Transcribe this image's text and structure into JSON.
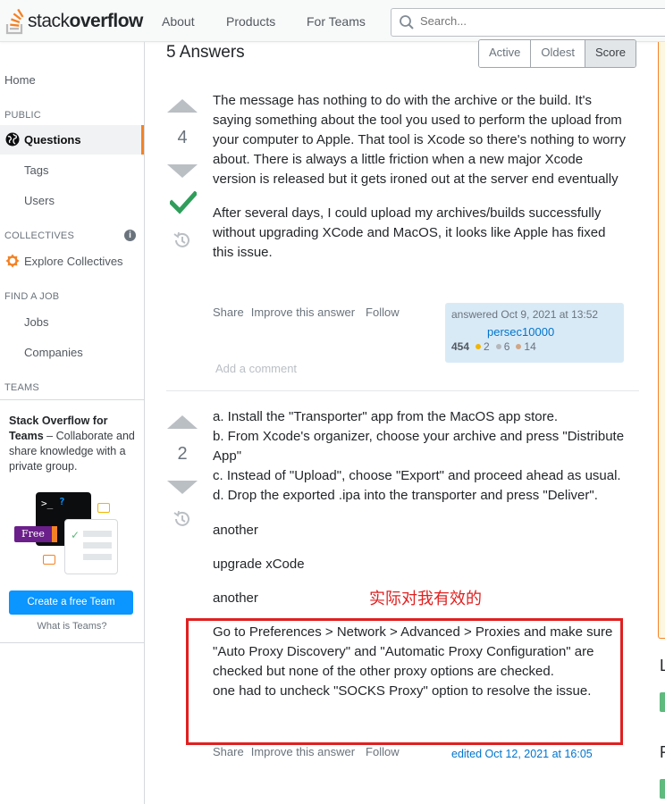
{
  "header": {
    "logo_plain": "stack",
    "logo_bold": "overflow",
    "nav": [
      "About",
      "Products",
      "For Teams"
    ],
    "search_placeholder": "Search..."
  },
  "sidebar": {
    "home": "Home",
    "public_label": "PUBLIC",
    "questions": "Questions",
    "tags": "Tags",
    "users": "Users",
    "collectives_label": "COLLECTIVES",
    "explore_collectives": "Explore Collectives",
    "find_job_label": "FIND A JOB",
    "jobs": "Jobs",
    "companies": "Companies",
    "teams_label": "TEAMS",
    "teams_title_bold": "Stack Overflow for Teams",
    "teams_title_rest": " – Collaborate and share knowledge with a private group.",
    "free_badge": "Free",
    "create_team": "Create a free Team",
    "what_is_teams": "What is Teams?"
  },
  "main": {
    "answers_count": "5 Answers",
    "sort_tabs": [
      "Active",
      "Oldest",
      "Score"
    ],
    "answer1": {
      "votes": "4",
      "paragraphs": [
        "The message has nothing to do with the archive or the build. It's saying something about the tool you used to perform the upload from your computer to Apple. That tool is Xcode so there's nothing to worry about. There is always a little friction when a new major Xcode version is released but it gets ironed out at the server end eventually",
        "After several days, I could upload my archives/builds successfully without upgrading XCode and MacOS, it looks like Apple has fixed this issue."
      ],
      "menu": [
        "Share",
        "Improve this answer",
        "Follow"
      ],
      "answered": "answered Oct 9, 2021 at 13:52",
      "user": "persec10000",
      "rep": "454",
      "gold": "2",
      "silver": "6",
      "bronze": "14",
      "add_comment": "Add a comment"
    },
    "answer2": {
      "votes": "2",
      "lines": [
        "a. Install the \"Transporter\" app from the MacOS app store.",
        "b. From Xcode's organizer, choose your archive and press \"Distribute App\"",
        "c. Instead of \"Upload\", choose \"Export\" and proceed ahead as usual.",
        "d. Drop the exported .ipa into the transporter and press \"Deliver\"."
      ],
      "another1": "another",
      "upgrade": "upgrade xCode",
      "another2": "another",
      "proxy_lines": [
        "Go to Preferences > Network > Advanced > Proxies and make sure \"Auto Proxy Discovery\" and \"Automatic Proxy Configuration\" are checked but none of the other proxy options are checked.",
        "one had to uncheck \"SOCKS Proxy\" option to resolve the issue."
      ],
      "menu": [
        "Share",
        "Improve this answer",
        "Follow"
      ],
      "edited": "edited Oct 12, 2021 at 16:05"
    },
    "annotation": "实际对我有效的"
  },
  "right_edge": {
    "letter1": "L",
    "letter2": "R"
  },
  "colors": {
    "accent_orange": "#f48225",
    "link_blue": "#0074cc",
    "accepted_green": "#2f9e5b",
    "annotation_red": "#e02020",
    "cta_blue": "#0a95ff"
  },
  "icons": [
    "search-icon",
    "globe-icon",
    "info-icon",
    "collectives-icon",
    "vote-up-icon",
    "vote-down-icon",
    "accepted-check-icon",
    "history-icon"
  ]
}
